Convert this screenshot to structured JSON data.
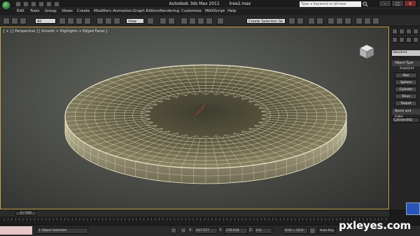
{
  "titlebar": {
    "app": "Autodesk 3ds Max  2011",
    "file": "tree2.max",
    "search_placeholder": "Type a keyword or phrase",
    "minimize": "–",
    "maximize": "□",
    "close": "×"
  },
  "menubar": {
    "items": [
      "Edit",
      "Tools",
      "Group",
      "Views",
      "Create",
      "Modifiers",
      "Animation",
      "Graph Editors",
      "Rendering",
      "Customize",
      "MAXScript",
      "Help"
    ]
  },
  "toolbar": {
    "selection_filter": "All",
    "view_dropdown": "View",
    "named_selection_placeholder": "Create Selection Se"
  },
  "viewport": {
    "label": "[ + ] [ Perspective ] [ Smooth + Highlights + Edged Faces ]",
    "border_color": "#c8a84a"
  },
  "command_panel": {
    "category": "Standard Primitives",
    "object_type_label": "Object Type",
    "autogrid_label": "AutoGrid",
    "buttons": [
      "Box",
      "Sphere",
      "Cylinder",
      "Torus",
      "Teapot"
    ],
    "name_color_label": "Name and Color",
    "object_name": "Cylinder002"
  },
  "timeline": {
    "frame": "0 / 100"
  },
  "statusbar": {
    "selection": "1 Object Selected",
    "x_label": "X:",
    "x_value": "217.577",
    "y_label": "Y:",
    "y_value": "276.634",
    "z_label": "Z:",
    "z_value": "0.0",
    "grid": "Grid = 10.0",
    "autokey": "Auto Key"
  },
  "watermark": "pxleyes.com"
}
